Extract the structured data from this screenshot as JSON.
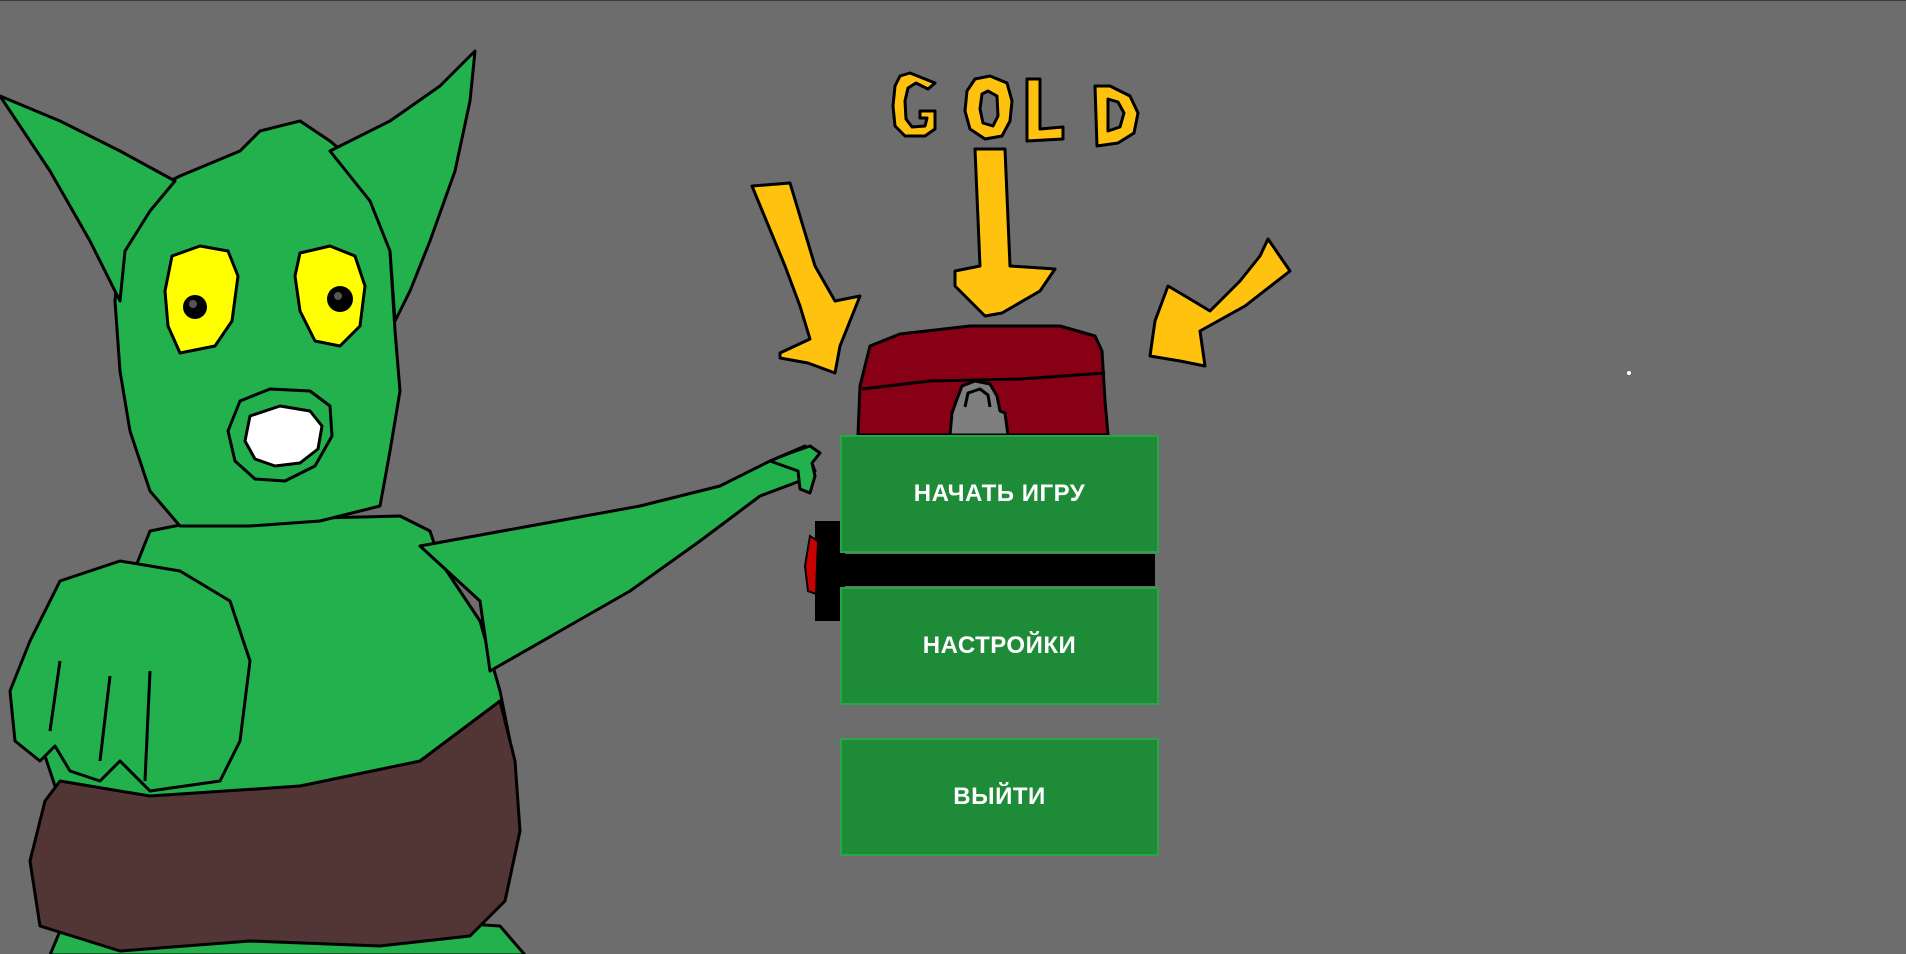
{
  "menu": {
    "start_label": "НАЧАТЬ ИГРУ",
    "settings_label": "НАСТРОЙКИ",
    "exit_label": "ВЫЙТИ"
  },
  "artwork": {
    "sign_text": "GOLD",
    "icons": [
      "goblin-character",
      "treasure-chest",
      "gold-arrow-left",
      "gold-arrow-center",
      "gold-arrow-right",
      "dagger"
    ]
  },
  "colors": {
    "background": "#6d6d6d",
    "button": "#1e8b39",
    "goblin_skin": "#22b14c",
    "loincloth": "#523535",
    "gold": "#ffc20e",
    "chest": "#880015",
    "eyes": "#ffff00"
  }
}
